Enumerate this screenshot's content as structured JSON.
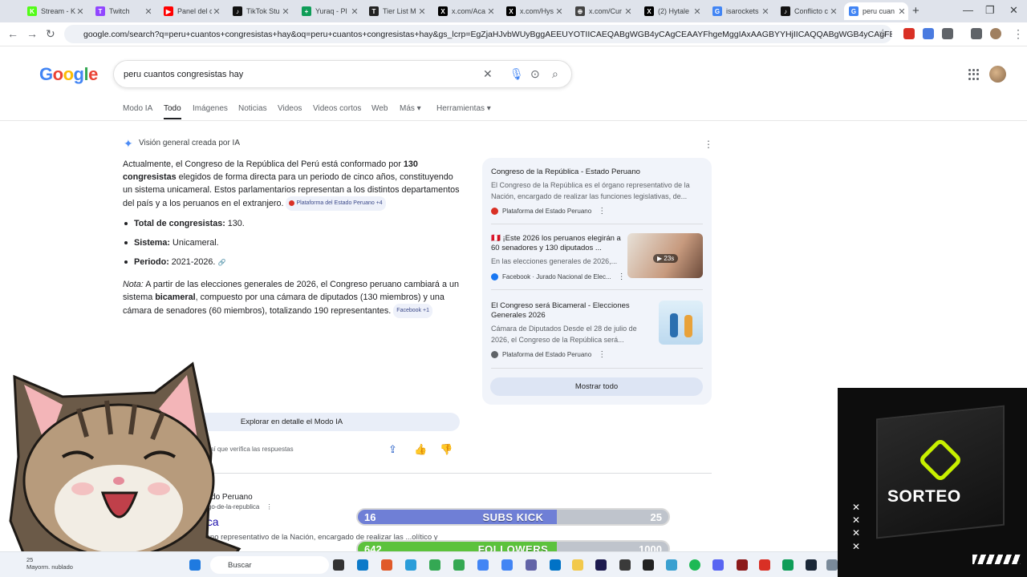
{
  "browser": {
    "tabs": [
      {
        "label": "Stream - K",
        "color": "#53fc18",
        "glyph": "K"
      },
      {
        "label": "Twitch",
        "color": "#9146ff",
        "glyph": "T"
      },
      {
        "label": "Panel del c",
        "color": "#ff0000",
        "glyph": "▶"
      },
      {
        "label": "TikTok Stu",
        "color": "#111111",
        "glyph": "♪"
      },
      {
        "label": "Yuraq - Pl",
        "color": "#0f9d58",
        "glyph": "+"
      },
      {
        "label": "Tier List M",
        "color": "#222222",
        "glyph": "T"
      },
      {
        "label": "x.com/Aca",
        "color": "#000000",
        "glyph": "X"
      },
      {
        "label": "x.com/Hys",
        "color": "#000000",
        "glyph": "X"
      },
      {
        "label": "x.com/Cur",
        "color": "#444444",
        "glyph": "⊕"
      },
      {
        "label": "(2) Hytale",
        "color": "#000000",
        "glyph": "X"
      },
      {
        "label": "isarockets",
        "color": "#4285f4",
        "glyph": "G"
      },
      {
        "label": "Conflicto c",
        "color": "#111111",
        "glyph": "♪"
      },
      {
        "label": "peru cuan",
        "color": "#4285f4",
        "glyph": "G"
      }
    ],
    "url": "google.com/search?q=peru+cuantos+congresistas+hay&oq=peru+cuantos+congresistas+hay&gs_lcrp=EgZjaHJvbWUyBggAEEUYOTIICAEQABgWGB4yCAgCEAAYFhgeMggIAxAAGBYYHjIICAQQABgWGB4yCAgFEAAYFhgeMggIBhAAGBYY..."
  },
  "google": {
    "logo": "Google",
    "query": "peru cuantos congresistas hay",
    "filters": [
      "Modo IA",
      "Todo",
      "Imágenes",
      "Noticias",
      "Videos",
      "Videos cortos",
      "Web",
      "Más",
      "Herramientas"
    ],
    "active_filter": "Todo"
  },
  "ai": {
    "title": "Visión general creada por IA",
    "para1_a": "Actualmente, el Congreso de la República del Perú está conformado por ",
    "para1_b": "130 congresistas",
    "para1_c": " elegidos de forma directa para un periodo de cinco años, constituyendo un sistema unicameral. Estos parlamentarios representan a los distintos departamentos del país y a los peruanos en el extranjero.",
    "chip1": "Plataforma del Estado Peruano +4",
    "bullets": [
      {
        "k": "Total de congresistas:",
        "v": " 130."
      },
      {
        "k": "Sistema:",
        "v": " Unicameral."
      },
      {
        "k": "Periodo:",
        "v": " 2021-2026."
      }
    ],
    "note_label": "Nota:",
    "note_a": " A partir de las elecciones generales de 2026, el Congreso peruano cambiará a un sistema ",
    "note_b": "bicameral",
    "note_c": ", compuesto por una cámara de diputados (130 miembros) y una cámara de senadores (60 miembros), totalizando 190 representantes.",
    "chip2": "Facebook +1",
    "explore": "Explorar en detalle el Modo IA",
    "verify": "así que verifica las respuestas"
  },
  "sources": [
    {
      "title": "Congreso de la República - Estado Peruano",
      "desc": "El Congreso de la República es el órgano representativo de la Nación, encargado de realizar las funciones legislativas, de...",
      "site": "Plataforma del Estado Peruano"
    },
    {
      "title": "🇵🇪 ¡Este 2026 los peruanos elegirán a 60 senadores y 130 diputados ...",
      "desc": "En las elecciones generales de 2026,...",
      "site": "Facebook · Jurado Nacional de Elec...",
      "badge": "23s"
    },
    {
      "title": "El Congreso será Bicameral - Elecciones Generales 2026",
      "desc": "Cámara de Diputados Desde el 28 de julio de 2026, el Congreso de la República será...",
      "site": "Plataforma del Estado Peruano"
    }
  ],
  "show_all": "Mostrar todo",
  "result": {
    "site": "Estado Peruano",
    "url": ".pe › ...go-de-la-republica",
    "title": "...ica",
    "snippet": "...órgano representativo de la Nación, encargado de realizar las ...olítico y las..."
  },
  "overlay": {
    "subs": {
      "label": "SUBS KICK",
      "current": "16",
      "goal": "25",
      "progress": 0.64,
      "color": "#6f7fd6"
    },
    "followers": {
      "label": "FOLLOWERS",
      "current": "642",
      "goal": "1000",
      "progress": 0.642,
      "color": "#5cc23c"
    },
    "promo": "SORTEO"
  },
  "taskbar": {
    "search": "Buscar",
    "weather_temp": "25",
    "weather_text": "Mayorm. nublado"
  }
}
